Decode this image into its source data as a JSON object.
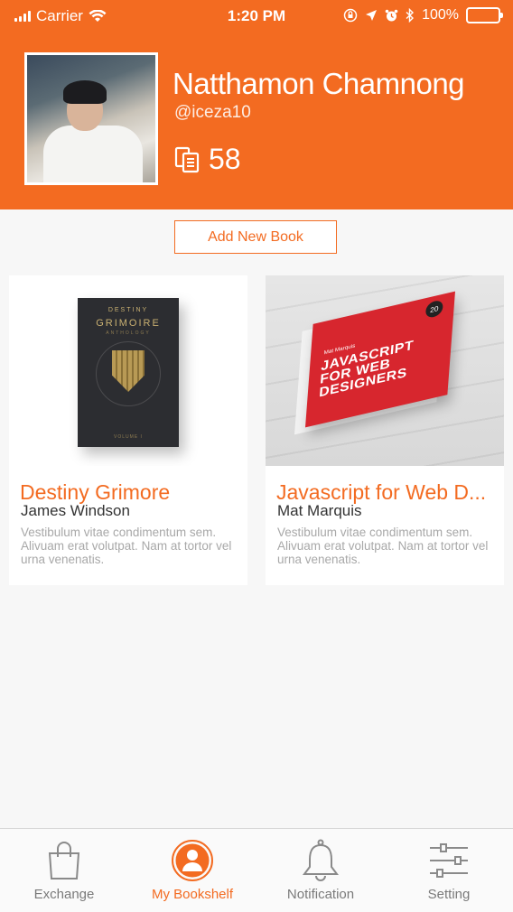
{
  "status_bar": {
    "carrier": "Carrier",
    "time": "1:20 PM",
    "battery": "100%"
  },
  "profile": {
    "name": "Natthamon Chamnong",
    "handle": "@iceza10",
    "book_count": "58"
  },
  "actions": {
    "add_book_label": "Add New Book"
  },
  "books": [
    {
      "title": "Destiny Grimore",
      "author": "James Windson",
      "description": "Vestibulum vitae condimentum sem. Alivuam erat volutpat. Nam at tortor vel urna venenatis.",
      "cover_text": {
        "top": "DESTINY",
        "main": "GRIMOIRE",
        "sub": "ANTHOLOGY",
        "volume": "VOLUME I"
      }
    },
    {
      "title": "Javascript for Web D...",
      "author": "Mat Marquis",
      "description": "Vestibulum vitae condimentum sem. Alivuam erat volutpat. Nam at tortor vel urna venenatis.",
      "cover_text": {
        "badge": "20",
        "author": "Mat Marquis",
        "main": "JAVASCRIPT FOR WEB DESIGNERS"
      }
    }
  ],
  "tabs": [
    {
      "label": "Exchange",
      "icon": "shopping-bag-icon"
    },
    {
      "label": "My Bookshelf",
      "icon": "person-icon"
    },
    {
      "label": "Notification",
      "icon": "bell-icon"
    },
    {
      "label": "Setting",
      "icon": "sliders-icon"
    }
  ],
  "colors": {
    "accent": "#f36b21",
    "background": "#f7f7f7",
    "muted": "#a8a8a8"
  }
}
